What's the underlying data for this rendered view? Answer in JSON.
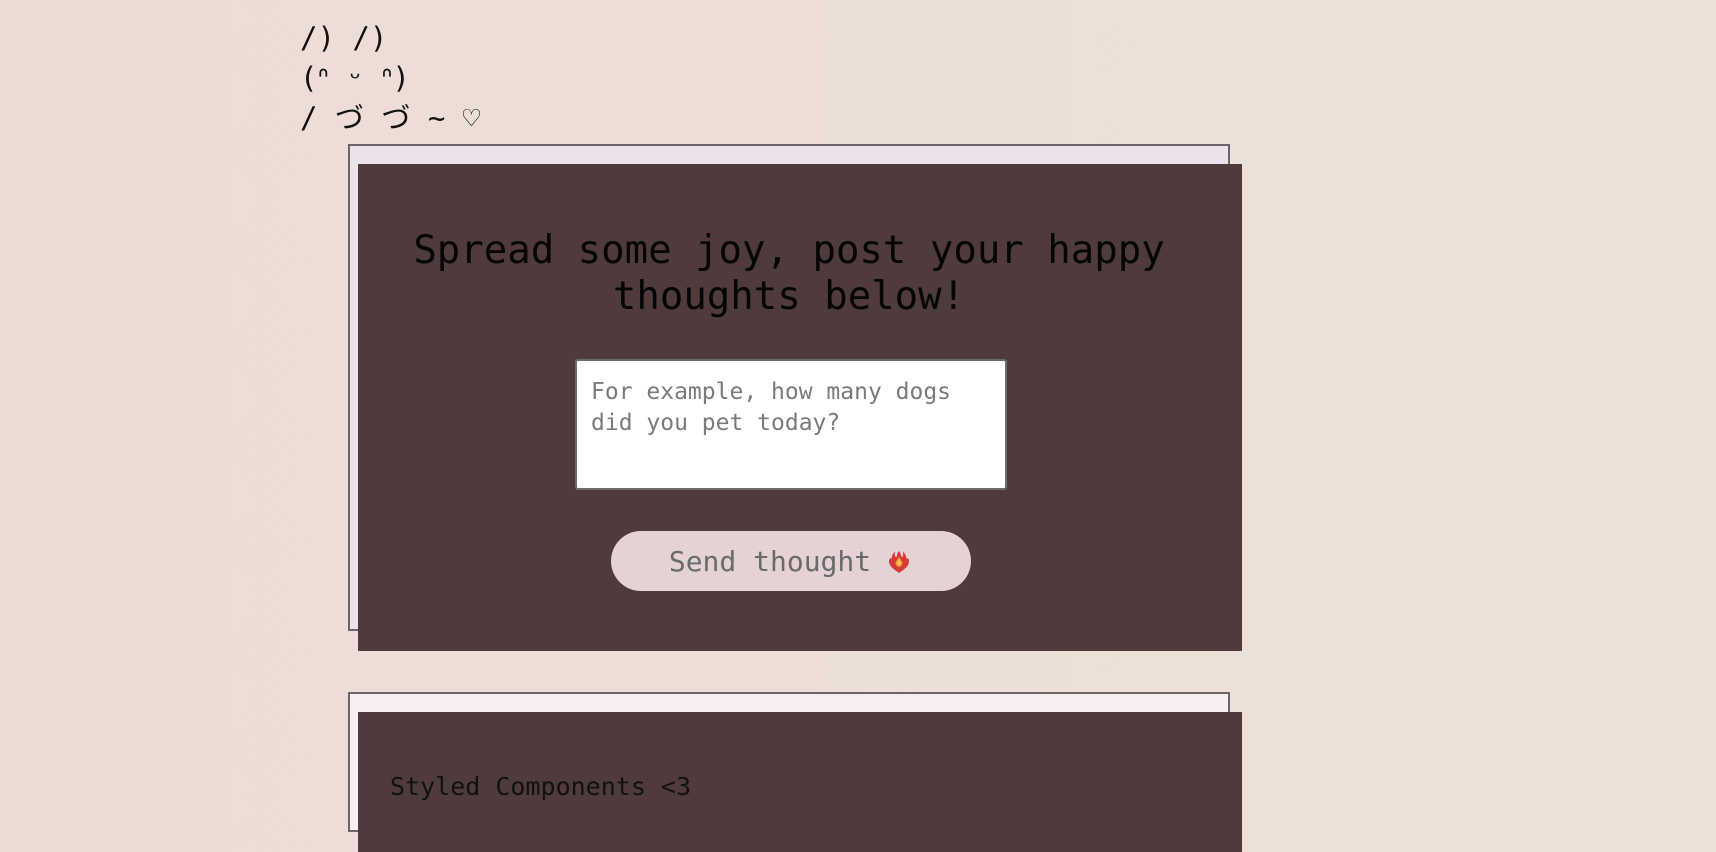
{
  "header": {
    "bunny_lines": [
      "/) /)",
      "(ᐢ ᵕ ᐢ)",
      "/ づ づ ~ ♡"
    ]
  },
  "form": {
    "title": "Spread some joy, post your happy thoughts below!",
    "input": {
      "value": "",
      "placeholder": "For example, how many dogs did you pet today?"
    },
    "send_button": {
      "label": "Send thought",
      "icon": "heart-on-fire-icon"
    }
  },
  "messages": [
    {
      "text": "Styled Components <3"
    }
  ],
  "colors": {
    "background_left": "#eddcd6",
    "background_right": "#eee2d8",
    "form_card_bg": "#ebe2ea",
    "message_card_bg": "#f7eef2",
    "card_shadow": "#4f3a3c",
    "button_bg": "#e4d2d5",
    "button_text": "#6a6a6a"
  }
}
